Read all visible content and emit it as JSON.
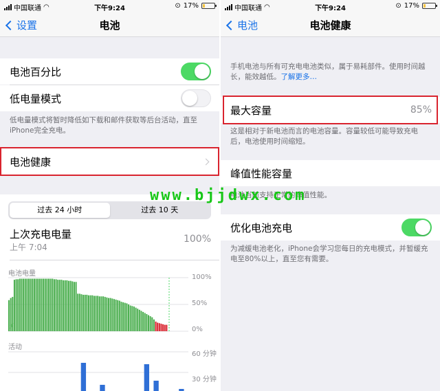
{
  "status": {
    "carrier": "中国联通",
    "time": "下午9:24",
    "battery_percent": "17%"
  },
  "left": {
    "nav": {
      "back_label": "设置",
      "title": "电池"
    },
    "battery_percentage": {
      "label": "电池百分比",
      "on": true
    },
    "low_power": {
      "label": "低电量模式",
      "on": false
    },
    "low_power_footer": "低电量模式将暂时降低如下载和邮件获取等后台活动，直至iPhone完全充电。",
    "battery_health_label": "电池健康",
    "segments": [
      "过去 24 小时",
      "过去 10 天"
    ],
    "last_charge": {
      "label": "上次充电电量",
      "time": "上午 7:04",
      "value": "100%"
    },
    "battery_level_label": "电池电量",
    "battery_ticks": [
      "100%",
      "50%",
      "0%"
    ],
    "activity_label": "活动",
    "activity_ticks": [
      "60 分钟",
      "30 分钟"
    ]
  },
  "right": {
    "nav": {
      "back_label": "电池",
      "title": "电池健康"
    },
    "intro": "手机电池与所有可充电电池类似，属于易耗部件。使用时间越长，能效越低。",
    "learn_more": "了解更多…",
    "max_capacity": {
      "label": "最大容量",
      "value": "85%"
    },
    "max_capacity_footer": "这是相对于新电池而言的电池容量。容量较低可能导致充电后，电池使用时间缩短。",
    "peak_label": "峰值性能容量",
    "peak_footer": "电池当前支持正常的峰值性能。",
    "optimized": {
      "label": "优化电池充电",
      "on": true
    },
    "optimized_footer": "为减缓电池老化，iPhone会学习您每日的充电模式，并暂缓充电至80%以上，直至您有需要。"
  },
  "watermark": "www.bjjdwx.com",
  "colors": {
    "accent": "#1a73e8",
    "toggle_on": "#4cd964",
    "highlight": "#d9232e",
    "battery_green": "#4caf50",
    "battery_red": "#d9232e",
    "activity_blue": "#2f6fd6"
  },
  "chart_data": [
    {
      "type": "bar",
      "title": "电池电量",
      "ylim": [
        0,
        100
      ],
      "ytick_labels": [
        "100%",
        "50%",
        "0%"
      ],
      "values": [
        58,
        62,
        64,
        96,
        97,
        97,
        98,
        98,
        98,
        98,
        98,
        98,
        98,
        98,
        98,
        98,
        98,
        98,
        98,
        98,
        98,
        98,
        98,
        98,
        98,
        97,
        97,
        96,
        96,
        96,
        95,
        95,
        95,
        94,
        94,
        93,
        92,
        92,
        70,
        70,
        69,
        68,
        68,
        68,
        67,
        67,
        67,
        66,
        66,
        66,
        65,
        65,
        65,
        64,
        63,
        62,
        62,
        61,
        60,
        59,
        58,
        57,
        55,
        54,
        53,
        52,
        50,
        48,
        47,
        46,
        44,
        42,
        40,
        38,
        36,
        34,
        32,
        30,
        28,
        26,
        22,
        18,
        16,
        15,
        14,
        13,
        12,
        12
      ]
    },
    {
      "type": "bar",
      "title": "活动",
      "ytick_labels": [
        "60 分钟",
        "30 分钟"
      ],
      "values": [
        0,
        0,
        0,
        0,
        0,
        0,
        0,
        0,
        0,
        0,
        0,
        0,
        0,
        0,
        0,
        0,
        0,
        0,
        0,
        0,
        0,
        0,
        0,
        44,
        0,
        0,
        0,
        0,
        0,
        12,
        0,
        0,
        0,
        0,
        0,
        0,
        0,
        0,
        0,
        0,
        0,
        0,
        0,
        42,
        0,
        0,
        18,
        0,
        0,
        0,
        0,
        0,
        0,
        0,
        6,
        0,
        0
      ]
    }
  ]
}
